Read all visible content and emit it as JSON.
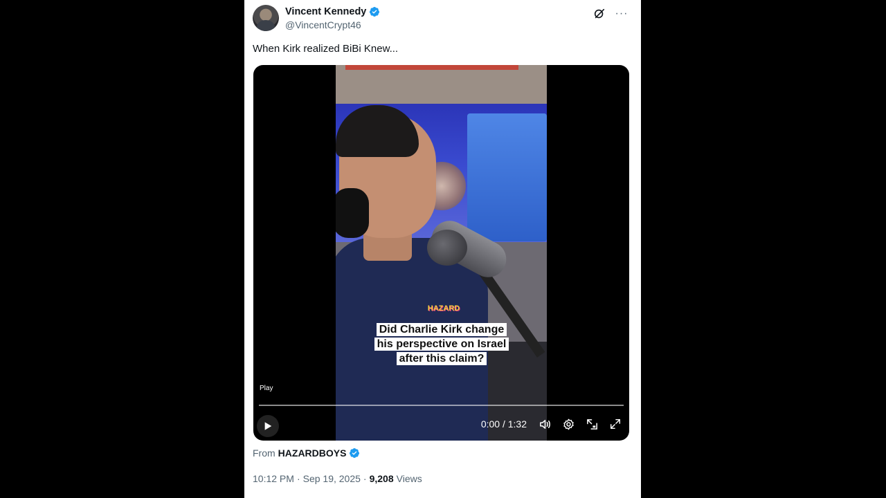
{
  "author": {
    "display_name": "Vincent Kennedy",
    "handle": "@VincentCrypt46",
    "verified": true
  },
  "header_actions": {
    "grok_icon": "grok-icon",
    "more_label": "···"
  },
  "tweet": {
    "text": "When Kirk realized BiBi Knew..."
  },
  "video": {
    "caption": "Did Charlie Kirk change his perspective on Israel after this claim?",
    "badge_text": "HAZARD BOYS",
    "play_label": "Play",
    "current_time": "0:00",
    "duration": "1:32",
    "time_display": "0:00 / 1:32",
    "progress": 0.0
  },
  "source": {
    "from_label": "From",
    "name": "HAZARDBOYS",
    "verified": true
  },
  "meta": {
    "time": "10:12 PM",
    "date": "Sep 19, 2025",
    "separator": "·",
    "views_count": "9,208",
    "views_label": "Views"
  },
  "colors": {
    "verified_blue": "#1d9bf0",
    "text_primary": "#0f1419",
    "text_secondary": "#536471"
  }
}
